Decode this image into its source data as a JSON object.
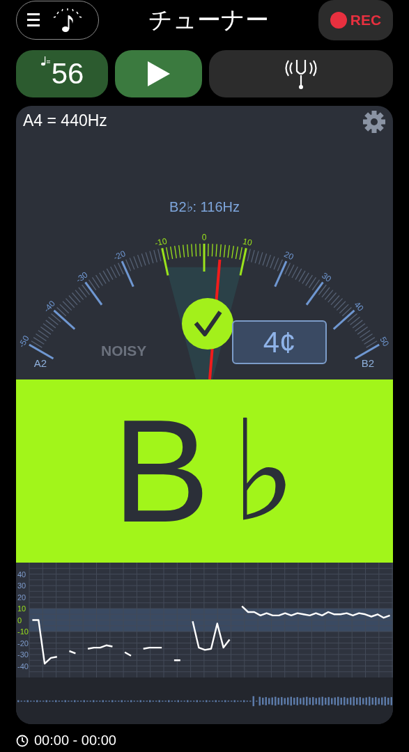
{
  "header": {
    "title": "チューナー",
    "rec_label": "REC"
  },
  "controls": {
    "tempo": "56"
  },
  "gauge": {
    "reference": "A4 = 440Hz",
    "detected": "B2♭: 116Hz",
    "in_tune": true,
    "cents": "4¢",
    "noise": "NOISY",
    "low_note": "A2",
    "high_note": "B2",
    "scale_labels": [
      "-50",
      "-40",
      "-30",
      "-20",
      "-10",
      "0",
      "10",
      "20",
      "30",
      "40",
      "50"
    ]
  },
  "note": {
    "name": "B",
    "accidental": "♭"
  },
  "history": {
    "chart_data": {
      "type": "line",
      "ylim": [
        -50,
        50
      ],
      "grid": true,
      "bands": [
        {
          "axis": "y",
          "from": -10,
          "to": 10
        }
      ],
      "yticks": [
        -40,
        -30,
        -20,
        -10,
        0,
        10,
        20,
        30,
        40
      ],
      "series": [
        {
          "color": "#ffffff",
          "values": [
            0,
            0,
            -38,
            -33,
            -32,
            null,
            -27,
            -29,
            null,
            -25,
            -24,
            -24,
            -22,
            -23,
            null,
            -28,
            -31,
            null,
            -25,
            -24,
            -24,
            -24,
            null,
            -35,
            -35,
            null,
            -1,
            -24,
            -26,
            -25,
            -3,
            -24,
            -17,
            null,
            12,
            7,
            7,
            4,
            6,
            4,
            4,
            6,
            4,
            6,
            5,
            4,
            6,
            4,
            7,
            5,
            5,
            6,
            4,
            6,
            5,
            3,
            5,
            2,
            4
          ]
        }
      ]
    }
  },
  "time": "00:00 - 00:00"
}
